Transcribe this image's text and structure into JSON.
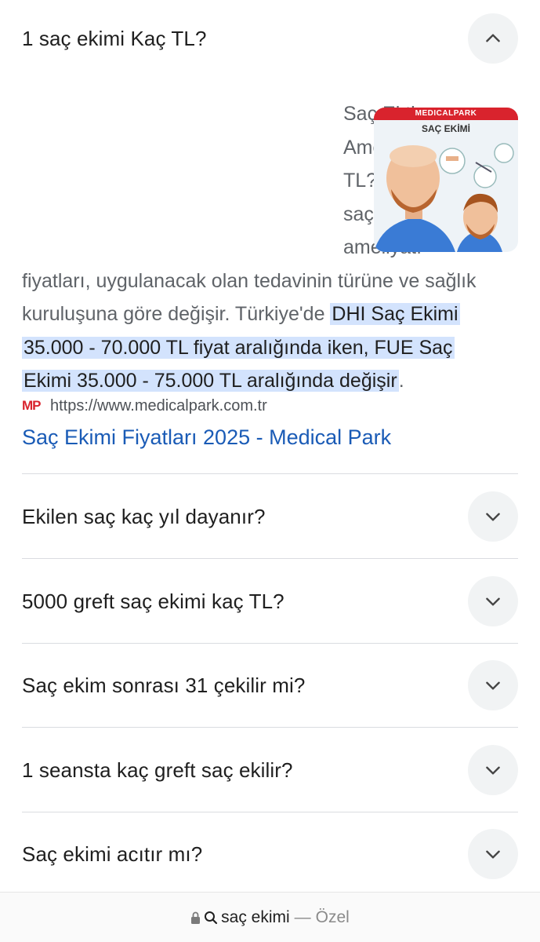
{
  "faq": {
    "open": {
      "question": "1 saç ekimi Kaç TL?",
      "answer_plain_1": "Saç Ektirme Ameliyatı Kaç TL? Türkiye'de saç ekimi ameliyatı fiyatları, uygulanacak olan tedavinin türüne ve sağlık kuruluşuna göre değişir. Türkiye'de ",
      "answer_highlight": "DHI Saç Ekimi 35.000 - 70.000 TL fiyat aralığında iken, FUE Saç Ekimi 35.000 - 75.000 TL aralığında değişir",
      "answer_plain_2": ".",
      "thumbnail": {
        "brand": "MEDICALPARK",
        "title": "SAÇ EKİMİ"
      },
      "source": {
        "favicon_text": "MP",
        "url": "https://www.medicalpark.com.tr",
        "link_title": "Saç Ekimi Fiyatları 2025 - Medical Park"
      }
    },
    "items": [
      {
        "question": "Ekilen saç kaç yıl dayanır?"
      },
      {
        "question": "5000 greft saç ekimi kaç TL?"
      },
      {
        "question": "Saç ekim sonrası 31 çekilir mi?"
      },
      {
        "question": "1 seansta kaç greft saç ekilir?"
      },
      {
        "question": "Saç ekimi acıtır mı?"
      }
    ]
  },
  "bottom_bar": {
    "query": "saç ekimi",
    "separator": "—",
    "mode": "Özel"
  },
  "colors": {
    "link": "#1a5bb6",
    "highlight": "#d3e3fd",
    "brand_red": "#d9232d"
  }
}
